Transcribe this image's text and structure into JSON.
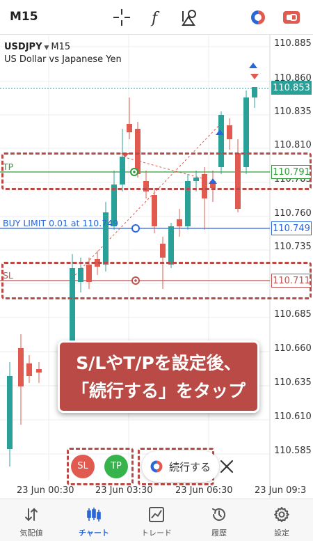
{
  "toolbar": {
    "timeframe": "M15",
    "icons": [
      "crosshair-icon",
      "function-icon",
      "objects-icon",
      "trade-icon",
      "switch-account-icon"
    ]
  },
  "chart": {
    "symbol": "USDJPY",
    "timeframe": "M15",
    "description": "US Dollar vs Japanese Yen",
    "price_axis": [
      "110.885",
      "110.860",
      "110.835",
      "110.810",
      "110.785",
      "110.760",
      "110.735",
      "110.685",
      "110.660",
      "110.635",
      "110.610",
      "110.585"
    ],
    "time_axis": [
      "23 Jun 00:30",
      "23 Jun 03:30",
      "23 Jun 06:30",
      "23 Jun 09:3"
    ],
    "current_price": "110.853",
    "tp_label": "TP",
    "tp_price": "110.791",
    "buy_limit_label": "BUY LIMIT 0.01 at 110.749",
    "buy_limit_price": "110.749",
    "sl_label": "SL",
    "sl_price": "110.711",
    "colors": {
      "bull": "#2aa198",
      "bear": "#e05a4f",
      "tp": "#2e9d3a",
      "buy": "#2a66d9",
      "sl": "#c0504d",
      "accent": "#b94a45"
    }
  },
  "callout": {
    "line1": "S/LやT/Pを設定後、",
    "line2": "「続行する」をタップ"
  },
  "actions": {
    "sl": "SL",
    "tp": "TP",
    "continue": "続行する"
  },
  "nav": [
    {
      "label": "気配値",
      "icon": "quotes-icon"
    },
    {
      "label": "チャート",
      "icon": "chart-icon"
    },
    {
      "label": "トレード",
      "icon": "trade-chart-icon"
    },
    {
      "label": "履歴",
      "icon": "history-icon"
    },
    {
      "label": "設定",
      "icon": "settings-icon"
    }
  ]
}
